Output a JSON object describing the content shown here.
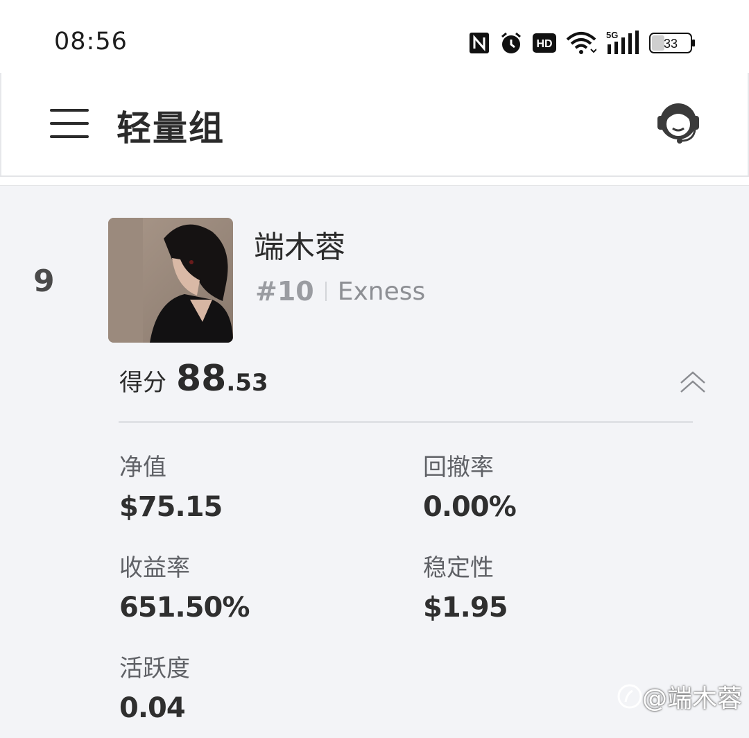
{
  "status_bar": {
    "time": "08:56",
    "icons": [
      "nfc-icon",
      "alarm-icon",
      "hd-icon",
      "wifi-icon",
      "5g-signal-icon",
      "battery-icon"
    ],
    "network": "5G",
    "hd_label": "HD",
    "battery": "33"
  },
  "header": {
    "title": "轻量组",
    "menu_icon": "hamburger-menu-icon",
    "support_icon": "customer-service-headset-icon"
  },
  "card": {
    "rank": "9",
    "name": "端木蓉",
    "account_no": "#10",
    "broker": "Exness",
    "score_label": "得分",
    "score_int": "88",
    "score_dec": ".53",
    "metrics": {
      "net_value": {
        "label": "净值",
        "value": "$75.15"
      },
      "drawdown": {
        "label": "回撤率",
        "value": "0.00%"
      },
      "return_rate": {
        "label": "收益率",
        "value": "651.50%"
      },
      "stability": {
        "label": "稳定性",
        "value": "$1.95"
      },
      "activity": {
        "label": "活跃度",
        "value": "0.04"
      }
    }
  },
  "watermark": "@端木蓉",
  "colors": {
    "card_bg": "#f3f4f7",
    "text_primary": "#2b2b2b",
    "text_muted": "#8d8f94"
  }
}
